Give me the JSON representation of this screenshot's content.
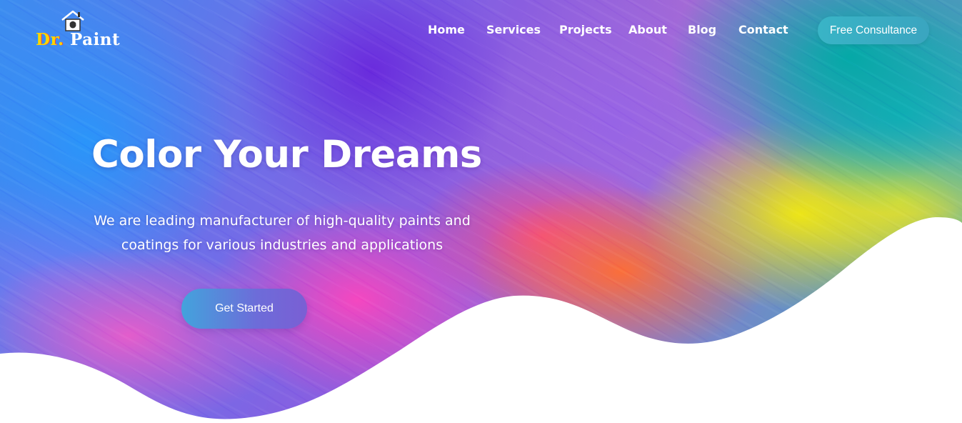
{
  "logo": {
    "text_prefix": "Dr.",
    "text_main": "Paint",
    "icon": "house-icon"
  },
  "nav": {
    "items": [
      {
        "label": "Home"
      },
      {
        "label": "Services"
      },
      {
        "label": "Projects"
      },
      {
        "label": "About"
      },
      {
        "label": "Blog"
      },
      {
        "label": "Contact"
      }
    ],
    "cta_label": "Free Consultance"
  },
  "hero": {
    "title": "Color Your Dreams",
    "subtitle": "We are leading manufacturer of high-quality paints and coatings for various industries and applications",
    "cta_label": "Get Started"
  },
  "colors": {
    "cta_top": "#39b4c6",
    "cta_hero_start": "#43a3dc",
    "cta_hero_end": "#7a5fd4",
    "text": "#ffffff",
    "wave": "#ffffff"
  }
}
